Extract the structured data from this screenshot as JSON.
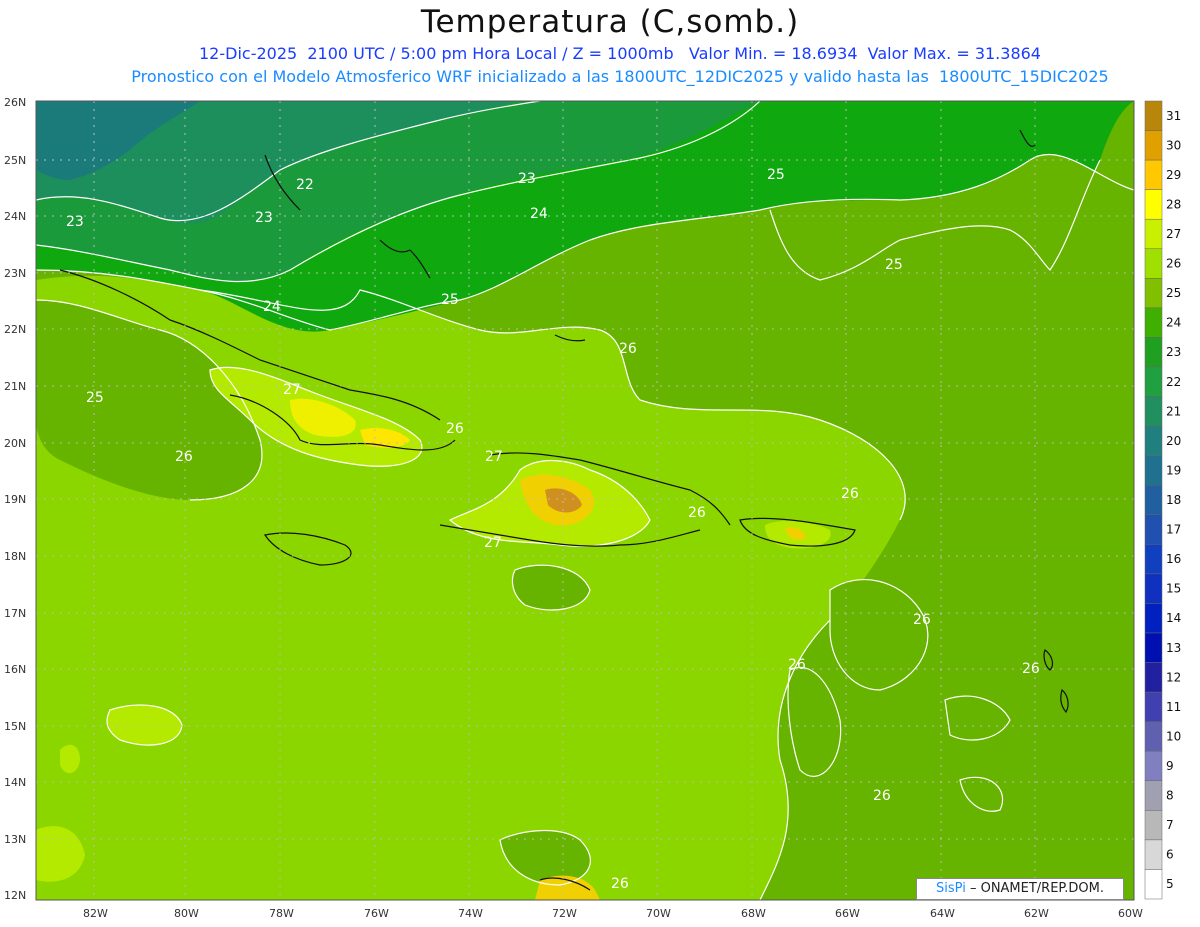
{
  "header": {
    "title": "Temperatura (C,somb.)",
    "subtitle1": "12-Dic-2025  2100 UTC / 5:00 pm Hora Local / Z = 1000mb   Valor Min. = 18.6934  Valor Max. = 31.3864",
    "subtitle2": "Pronostico con el Modelo Atmosferico WRF inicializado a las 1800UTC_12DIC2025 y valido hasta las  1800UTC_15DIC2025"
  },
  "axes": {
    "lat_labels": [
      "26N",
      "25N",
      "24N",
      "23N",
      "22N",
      "21N",
      "20N",
      "19N",
      "18N",
      "17N",
      "16N",
      "15N",
      "14N",
      "13N",
      "12N"
    ],
    "lon_labels": [
      "82W",
      "80W",
      "78W",
      "76W",
      "74W",
      "72W",
      "70W",
      "68W",
      "66W",
      "64W",
      "62W",
      "60W"
    ]
  },
  "colorbar": {
    "levels": [
      "31",
      "30",
      "29",
      "28",
      "27",
      "26",
      "25",
      "24",
      "23",
      "22",
      "21",
      "20",
      "19",
      "18",
      "17",
      "16",
      "15",
      "14",
      "13",
      "12",
      "11",
      "10",
      "9",
      "8",
      "7",
      "6",
      "5"
    ],
    "colors": [
      "#b8860b",
      "#e0a000",
      "#ffc800",
      "#ffff00",
      "#c8f000",
      "#a0e000",
      "#80c000",
      "#40b000",
      "#20a020",
      "#20a040",
      "#209060",
      "#208080",
      "#207090",
      "#2060a0",
      "#2050b0",
      "#1040c0",
      "#1030c0",
      "#0020c0",
      "#0010b0",
      "#2020a0",
      "#4040b0",
      "#6060b0",
      "#8080c0",
      "#a0a0b0",
      "#b8b8b8",
      "#d8d8d8",
      "#ffffff"
    ]
  },
  "contour_labels": {
    "c22": "22",
    "c23a": "23",
    "c23b": "23",
    "c23c": "23",
    "c24a": "24",
    "c24b": "24",
    "c25a": "25",
    "c25b": "25",
    "c25c": "25",
    "c25d": "25",
    "c26a": "26",
    "c26b": "26",
    "c26c": "26",
    "c26d": "26",
    "c26e": "26",
    "c26f": "26",
    "c26g": "26",
    "c26h": "26",
    "c26i": "26",
    "c26j": "26",
    "c26k": "26",
    "c27a": "27",
    "c27b": "27",
    "c27c": "27"
  },
  "credit": {
    "logo": "SisPi",
    "text": "– ONAMET/REP.DOM."
  }
}
